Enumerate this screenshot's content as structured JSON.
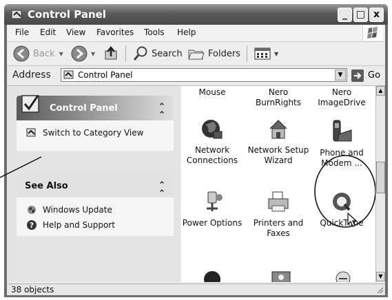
{
  "window": {
    "title": "Control Panel",
    "minimize": "_",
    "maximize": "□",
    "close": "x"
  },
  "menu": [
    "File",
    "Edit",
    "View",
    "Favorites",
    "Tools",
    "Help"
  ],
  "toolbar": {
    "back": "Back",
    "search": "Search",
    "folders": "Folders"
  },
  "address": {
    "label": "Address",
    "value": "Control Panel",
    "go": "Go"
  },
  "tasks": {
    "title": "Control Panel",
    "switch_view": "Switch to Category View"
  },
  "see_also": {
    "title": "See Also",
    "links": [
      "Windows Update",
      "Help and Support"
    ]
  },
  "items": [
    "Mouse",
    "Nero BurnRights",
    "Nero ImageDrive",
    "Network Connections",
    "Network Setup Wizard",
    "Phone and Modem ...",
    "Power Options",
    "Printers and Faxes",
    "QuickTime"
  ],
  "status": {
    "objects": "38 objects"
  }
}
